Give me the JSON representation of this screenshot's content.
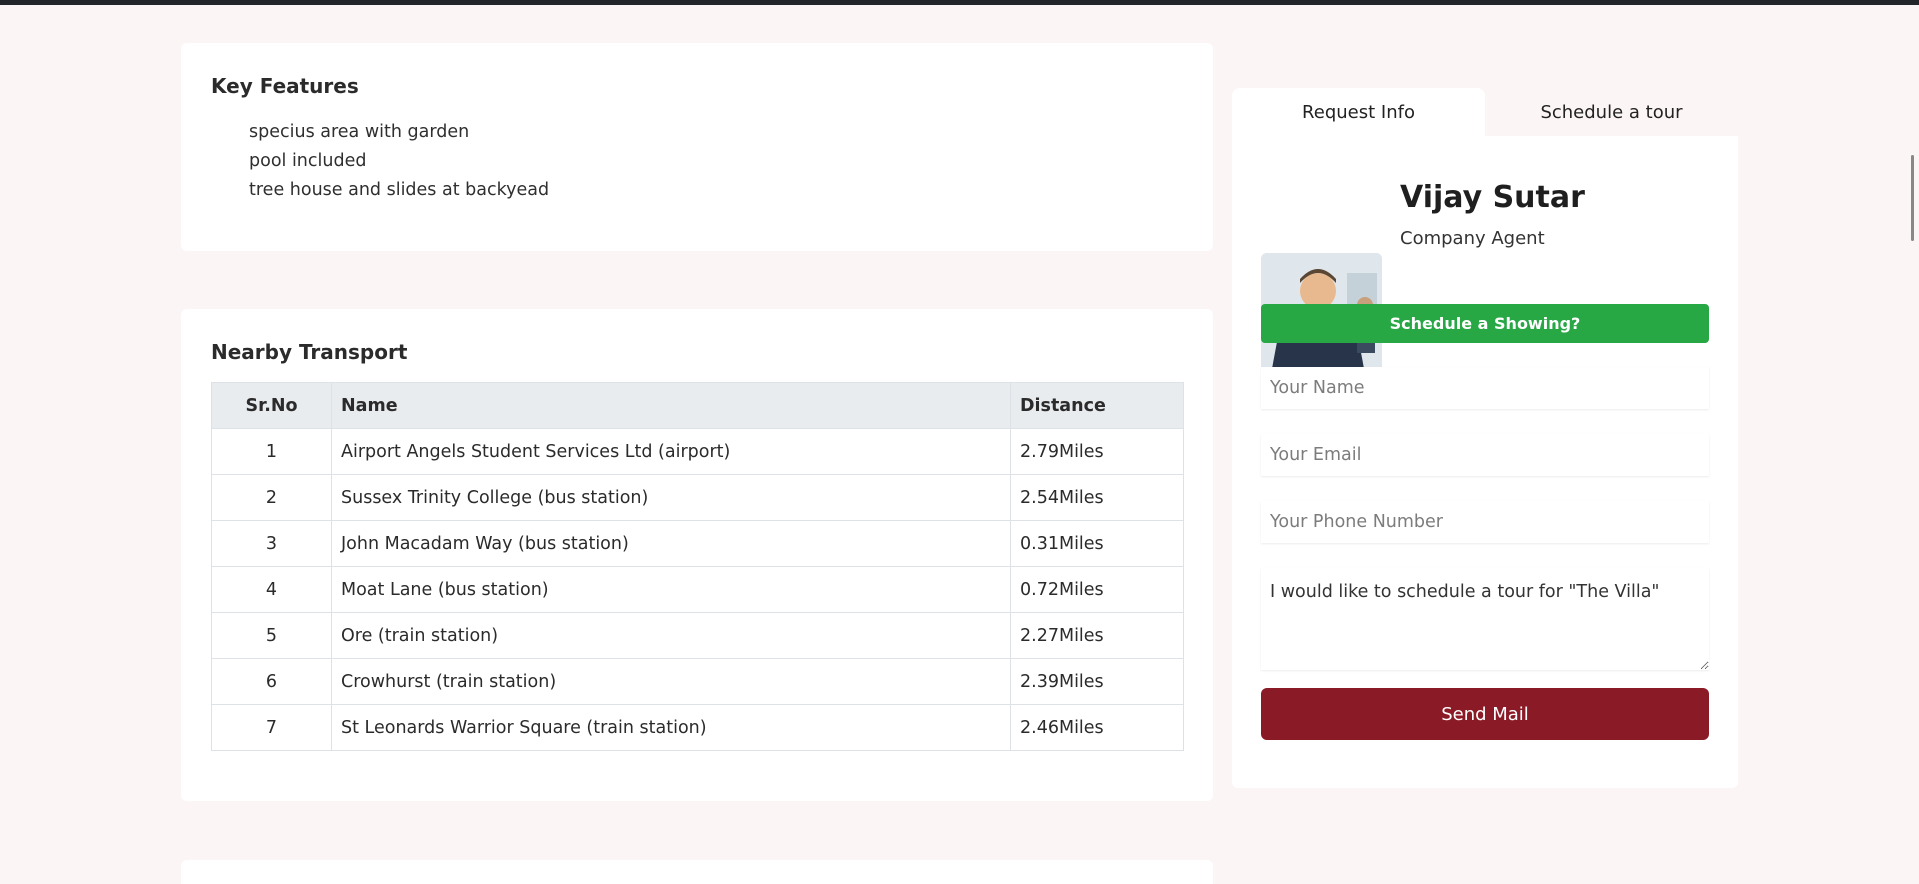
{
  "key_features": {
    "title": "Key Features",
    "items": [
      "specius area with garden",
      "pool included",
      "tree house and slides at backyead"
    ]
  },
  "nearby_transport": {
    "title": "Nearby Transport",
    "headers": [
      "Sr.No",
      "Name",
      "Distance"
    ],
    "rows": [
      [
        "1",
        "Airport Angels Student Services Ltd (airport)",
        "2.79Miles"
      ],
      [
        "2",
        "Sussex Trinity College (bus station)",
        "2.54Miles"
      ],
      [
        "3",
        "John Macadam Way (bus station)",
        "0.31Miles"
      ],
      [
        "4",
        "Moat Lane (bus station)",
        "0.72Miles"
      ],
      [
        "5",
        "Ore (train station)",
        "2.27Miles"
      ],
      [
        "6",
        "Crowhurst (train station)",
        "2.39Miles"
      ],
      [
        "7",
        "St Leonards Warrior Square (train station)",
        "2.46Miles"
      ]
    ]
  },
  "sidebar": {
    "tabs": [
      "Request Info",
      "Schedule a tour"
    ],
    "agent": {
      "name": "Vijay Sutar",
      "role": "Company Agent"
    },
    "schedule_button": "Schedule a Showing?",
    "form": {
      "name_placeholder": "Your Name",
      "email_placeholder": "Your Email",
      "phone_placeholder": "Your Phone Number",
      "message_value": "I would like to schedule a tour for \"The Villa\"",
      "send_label": "Send Mail"
    }
  },
  "colors": {
    "page_bg": "#fcf5f5",
    "showing_button": "#28a745",
    "send_button": "#8b1a27"
  }
}
